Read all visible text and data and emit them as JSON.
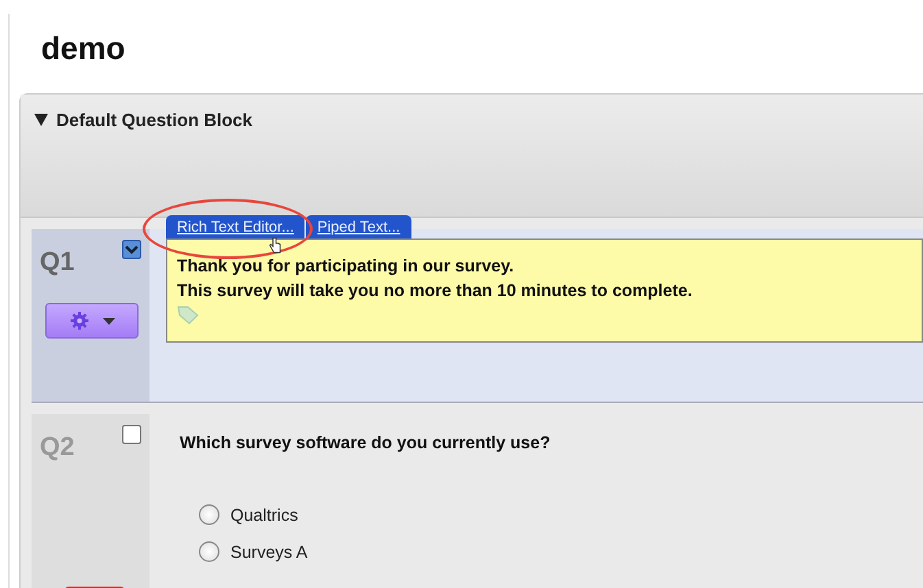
{
  "page": {
    "title": "demo"
  },
  "block": {
    "title": "Default Question Block",
    "expanded": true
  },
  "questions": [
    {
      "number": "Q1",
      "checked": true,
      "kind": "text",
      "tabs": [
        {
          "label": "Rich Text Editor..."
        },
        {
          "label": "Piped Text..."
        }
      ],
      "lines": [
        "Thank you for participating in our survey.",
        "This survey will take you no more than 10 minutes to complete."
      ]
    },
    {
      "number": "Q2",
      "checked": false,
      "kind": "choice",
      "text": "Which survey software do you currently use?",
      "options": [
        {
          "label": "Qualtrics",
          "selected": false
        },
        {
          "label": "Surveys A",
          "selected": false
        }
      ]
    }
  ]
}
